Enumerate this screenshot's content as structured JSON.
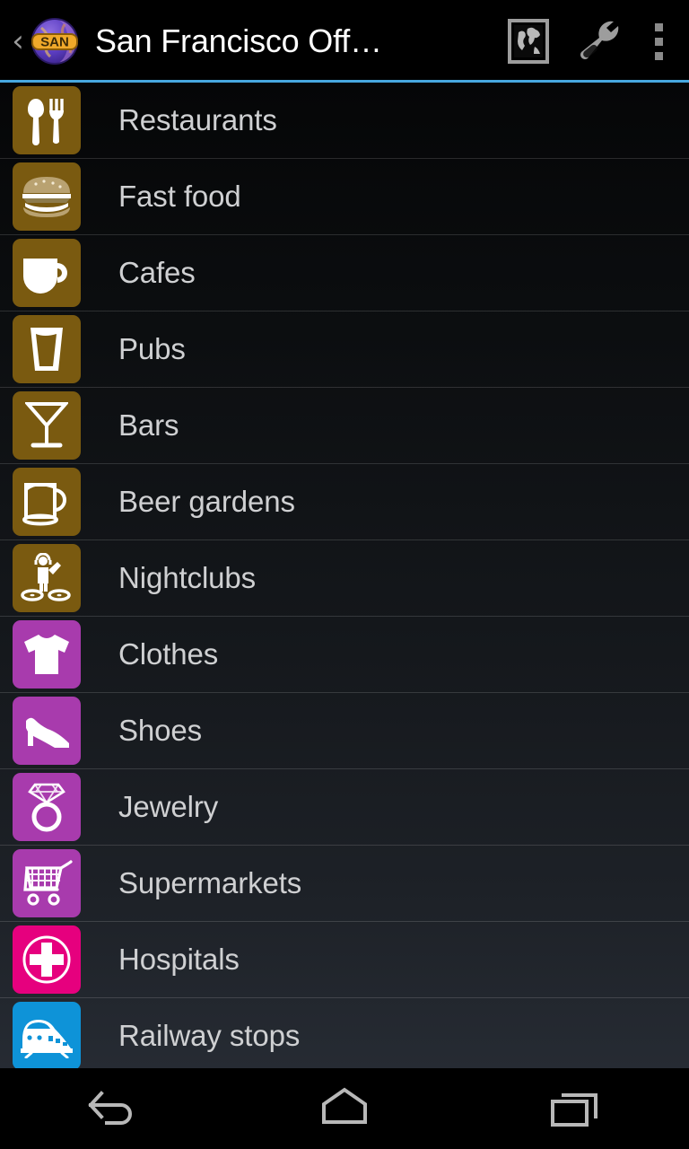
{
  "action_bar": {
    "back_label": "‹",
    "app_icon_name": "globe-san-icon",
    "app_icon_badge": "SAN",
    "title": "San Francisco Off…",
    "actions": [
      {
        "name": "world-map-icon",
        "label": "World map"
      },
      {
        "name": "wrench-icon",
        "label": "Settings"
      },
      {
        "name": "overflow-menu-icon",
        "label": "More options"
      }
    ],
    "accent_color": "#47a8e0"
  },
  "list": {
    "items": [
      {
        "label": "Restaurants",
        "icon": "cutlery-icon",
        "color": "#7A5A10"
      },
      {
        "label": "Fast food",
        "icon": "burger-icon",
        "color": "#7A5A10"
      },
      {
        "label": "Cafes",
        "icon": "coffee-cup-icon",
        "color": "#7A5A10"
      },
      {
        "label": "Pubs",
        "icon": "beer-glass-icon",
        "color": "#7A5A10"
      },
      {
        "label": "Bars",
        "icon": "cocktail-glass-icon",
        "color": "#7A5A10"
      },
      {
        "label": "Beer gardens",
        "icon": "beer-mug-icon",
        "color": "#7A5A10"
      },
      {
        "label": "Nightclubs",
        "icon": "dj-turntable-icon",
        "color": "#7A5A10"
      },
      {
        "label": "Clothes",
        "icon": "tshirt-icon",
        "color": "#A83BAD"
      },
      {
        "label": "Shoes",
        "icon": "high-heel-icon",
        "color": "#A83BAD"
      },
      {
        "label": "Jewelry",
        "icon": "diamond-ring-icon",
        "color": "#A83BAD"
      },
      {
        "label": "Supermarkets",
        "icon": "shopping-cart-icon",
        "color": "#A83BAD"
      },
      {
        "label": "Hospitals",
        "icon": "medical-cross-icon",
        "color": "#E6007E"
      },
      {
        "label": "Railway stops",
        "icon": "train-icon",
        "color": "#0E93D8"
      }
    ]
  },
  "nav_bar": {
    "buttons": [
      {
        "name": "nav-back-button",
        "label": "Back"
      },
      {
        "name": "nav-home-button",
        "label": "Home"
      },
      {
        "name": "nav-recents-button",
        "label": "Recent apps"
      }
    ]
  }
}
